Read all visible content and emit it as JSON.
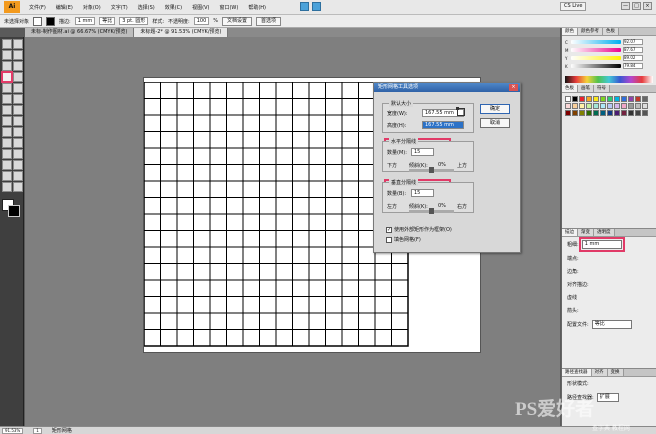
{
  "app": {
    "logo": "Ai",
    "menus": [
      "文件(F)",
      "编辑(E)",
      "对象(O)",
      "文字(T)",
      "选择(S)",
      "效果(C)",
      "视图(V)",
      "窗口(W)",
      "帮助(H)"
    ],
    "workspace": "CS Live",
    "window_controls": [
      "—",
      "□",
      "×"
    ]
  },
  "control_bar": {
    "selection_label": "未选择对象",
    "stroke_label": "描边:",
    "stroke_width": "1 mm",
    "dash_label": "等比",
    "brush_label": "3 pt. 圆形",
    "style_label": "样式:",
    "opacity_label": "不透明度:",
    "opacity_value": "100",
    "percent": "%",
    "doc_setup": "文档设置",
    "preferences": "首选项"
  },
  "documents": {
    "tab1": "未标-制作图材.ai @ 66.67% (CMYK/预览)",
    "tab2": "未标题-2* @ 91.53% (CMYK/预览)"
  },
  "dialog": {
    "title": "矩形网格工具选项",
    "default_size": "默认大小",
    "width_label": "宽度(W):",
    "width_value": "167.55 mm",
    "height_label": "高度(H):",
    "height_value": "167.55 mm",
    "horizontal": "水平分隔线",
    "h_count_label": "数量(M):",
    "h_count": "15",
    "bottom": "下方",
    "skew_label": "倾斜(K):",
    "h_skew": "0%",
    "top": "上方",
    "vertical": "垂直分隔线",
    "v_count_label": "数量(B):",
    "v_count": "15",
    "left": "左方",
    "v_skew": "0%",
    "right": "右方",
    "outer_rect": "使用外部矩形作为框架(O)",
    "fill_grid": "填色网格(F)",
    "ok": "确定",
    "cancel": "取消"
  },
  "right_panel": {
    "color_tabs": [
      "颜色",
      "颜色参考",
      "色板"
    ],
    "c": "92.07",
    "m": "87.67",
    "y": "89.02",
    "k": "79.84",
    "swatch_tabs": [
      "色板",
      "画笔",
      "符号"
    ],
    "stroke_tabs": [
      "描边",
      "渐变",
      "透明度"
    ],
    "stroke_weight_label": "粗细:",
    "stroke_weight": "1 mm",
    "cap_label": "端点:",
    "corner_label": "边角:",
    "align_label": "对齐描边:",
    "dash_label": "虚线",
    "arrow_label": "箭头:",
    "profile_label": "配置文件:",
    "profile_value": "等比",
    "appearance_tabs": [
      "路径查找器",
      "对齐",
      "变换"
    ],
    "shape_mode": "形状模式:",
    "path_finder": "路径查找器:",
    "expand": "扩展"
  },
  "status": {
    "zoom": "91.53%",
    "page": "1",
    "tool": "矩形网格"
  },
  "watermark": {
    "main": "PS爱好者",
    "sub": "查字典 教程网"
  },
  "colors": {
    "accent": "#e13a67",
    "title_blue": "#2f62a7"
  }
}
